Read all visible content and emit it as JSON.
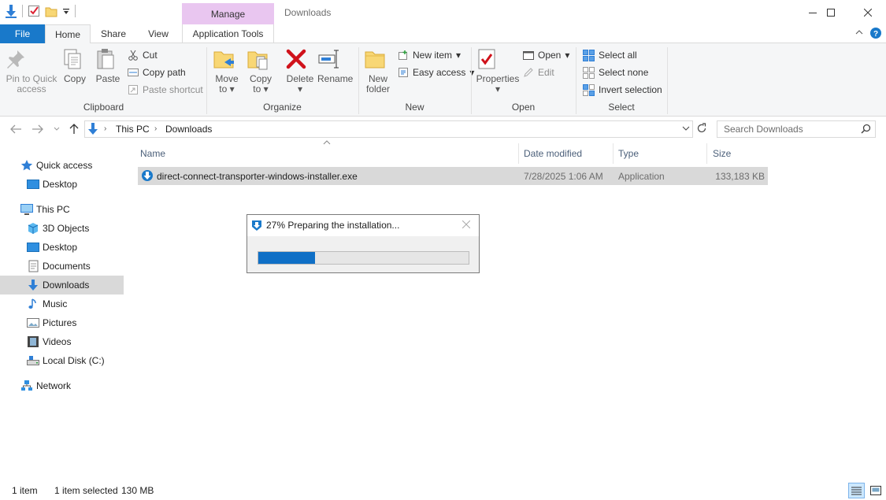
{
  "window": {
    "title": "Downloads",
    "context_tab_group": "Manage",
    "controls": {
      "minimize": "minimize-icon",
      "maximize": "maximize-icon",
      "close": "close-icon"
    }
  },
  "tabs": {
    "file": "File",
    "home": "Home",
    "share": "Share",
    "view": "View",
    "app_tools": "Application Tools"
  },
  "ribbon": {
    "clipboard": {
      "label": "Clipboard",
      "pin_line1": "Pin to Quick",
      "pin_line2": "access",
      "copy": "Copy",
      "paste": "Paste",
      "cut": "Cut",
      "copy_path": "Copy path",
      "paste_shortcut": "Paste shortcut"
    },
    "organize": {
      "label": "Organize",
      "move_to_line1": "Move",
      "move_to_line2": "to",
      "copy_to_line1": "Copy",
      "copy_to_line2": "to",
      "delete": "Delete",
      "rename": "Rename"
    },
    "new": {
      "label": "New",
      "new_folder_line1": "New",
      "new_folder_line2": "folder",
      "new_item": "New item",
      "easy_access": "Easy access"
    },
    "open": {
      "label": "Open",
      "properties": "Properties",
      "open": "Open",
      "edit": "Edit"
    },
    "select": {
      "label": "Select",
      "select_all": "Select all",
      "select_none": "Select none",
      "invert": "Invert selection"
    }
  },
  "address": {
    "crumb1": "This PC",
    "crumb2": "Downloads",
    "search_placeholder": "Search Downloads"
  },
  "nav_pane": {
    "quick_access": "Quick access",
    "desktop_qa": "Desktop",
    "this_pc": "This PC",
    "objects3d": "3D Objects",
    "desktop": "Desktop",
    "documents": "Documents",
    "downloads": "Downloads",
    "music": "Music",
    "pictures": "Pictures",
    "videos": "Videos",
    "local_disk": "Local Disk (C:)",
    "network": "Network"
  },
  "columns": {
    "name": "Name",
    "date": "Date modified",
    "type": "Type",
    "size": "Size"
  },
  "files": [
    {
      "name": "direct-connect-transporter-windows-installer.exe",
      "date": "7/28/2025 1:06 AM",
      "type": "Application",
      "size": "133,183 KB"
    }
  ],
  "progress_dialog": {
    "title": "27% Preparing the installation...",
    "percent": 27
  },
  "status": {
    "item_count": "1 item",
    "selection": "1 item selected",
    "size": "130 MB"
  },
  "colors": {
    "accent": "#1979ca",
    "manage_tab": "#e9c6f0",
    "selection": "#d9d9d9",
    "progress": "#0f6fc6"
  }
}
